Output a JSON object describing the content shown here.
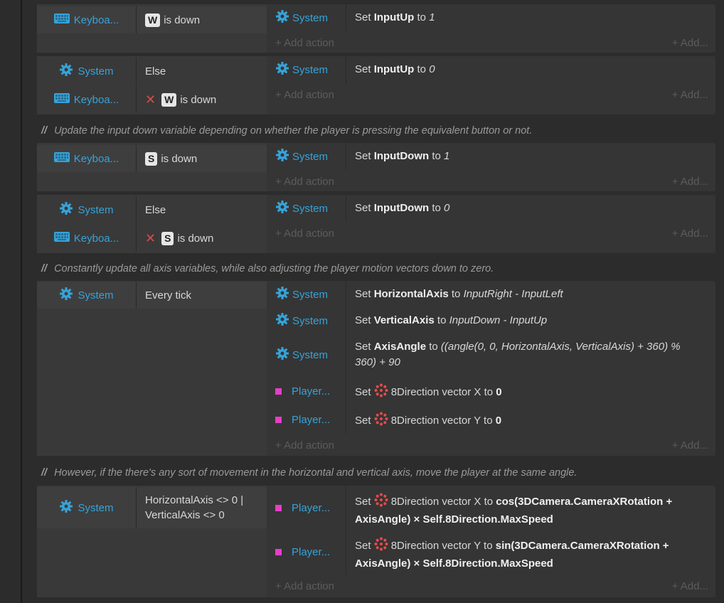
{
  "labels": {
    "keyboard": "Keyboa...",
    "system": "System",
    "player": "Player...",
    "add_action": "+ Add action",
    "add_small": "+ Add...",
    "else": "Else",
    "is_down": "is down",
    "every_tick": "Every tick",
    "set": "Set",
    "to": "to"
  },
  "events": [
    {
      "conditions": [
        {
          "object": "Keyboa...",
          "key": "W",
          "text": "is down"
        }
      ],
      "actions": [
        {
          "object": "System",
          "variable": "InputUp",
          "value": "1"
        }
      ]
    },
    {
      "conditions": [
        {
          "object": "System",
          "text": "Else"
        },
        {
          "object": "Keyboa...",
          "inverted": true,
          "key": "W",
          "text": "is down"
        }
      ],
      "actions": [
        {
          "object": "System",
          "variable": "InputUp",
          "value": "0"
        }
      ]
    },
    {
      "comment": "Update the input down variable depending on whether the player is pressing the equivalent button or not."
    },
    {
      "conditions": [
        {
          "object": "Keyboa...",
          "key": "S",
          "text": "is down"
        }
      ],
      "actions": [
        {
          "object": "System",
          "variable": "InputDown",
          "value": "1"
        }
      ]
    },
    {
      "conditions": [
        {
          "object": "System",
          "text": "Else"
        },
        {
          "object": "Keyboa...",
          "inverted": true,
          "key": "S",
          "text": "is down"
        }
      ],
      "actions": [
        {
          "object": "System",
          "variable": "InputDown",
          "value": "0"
        }
      ]
    },
    {
      "comment": "Constantly update all axis variables, while also adjusting the player motion vectors down to zero."
    },
    {
      "conditions": [
        {
          "object": "System",
          "text": "Every tick"
        }
      ],
      "actions": [
        {
          "object": "System",
          "variable": "HorizontalAxis",
          "value": "InputRight - InputLeft"
        },
        {
          "object": "System",
          "variable": "VerticalAxis",
          "value": "InputDown - InputUp"
        },
        {
          "object": "System",
          "variable": "AxisAngle",
          "value": "((angle(0, 0, HorizontalAxis, VerticalAxis) + 360) % 360) + 90"
        },
        {
          "object": "Player...",
          "behavior": "8Direction vector X",
          "value": "0"
        },
        {
          "object": "Player...",
          "behavior": "8Direction vector Y",
          "value": "0"
        }
      ]
    },
    {
      "comment": "However, if the there's any sort of movement in the horizontal and vertical axis, move the player at the same angle."
    },
    {
      "conditions": [
        {
          "object": "System",
          "text": "HorizontalAxis <> 0 | VerticalAxis <> 0"
        }
      ],
      "actions": [
        {
          "object": "Player...",
          "behavior": "8Direction vector X",
          "value": "cos(3DCamera.CameraXRotation + AxisAngle) × Self.8Direction.MaxSpeed"
        },
        {
          "object": "Player...",
          "behavior": "8Direction vector Y",
          "value": "sin(3DCamera.CameraXRotation + AxisAngle) × Self.8Direction.MaxSpeed"
        }
      ]
    }
  ],
  "colors": {
    "object_link": "#36a3d9",
    "player_marker": "#e63ec8",
    "invert": "#e04848"
  }
}
